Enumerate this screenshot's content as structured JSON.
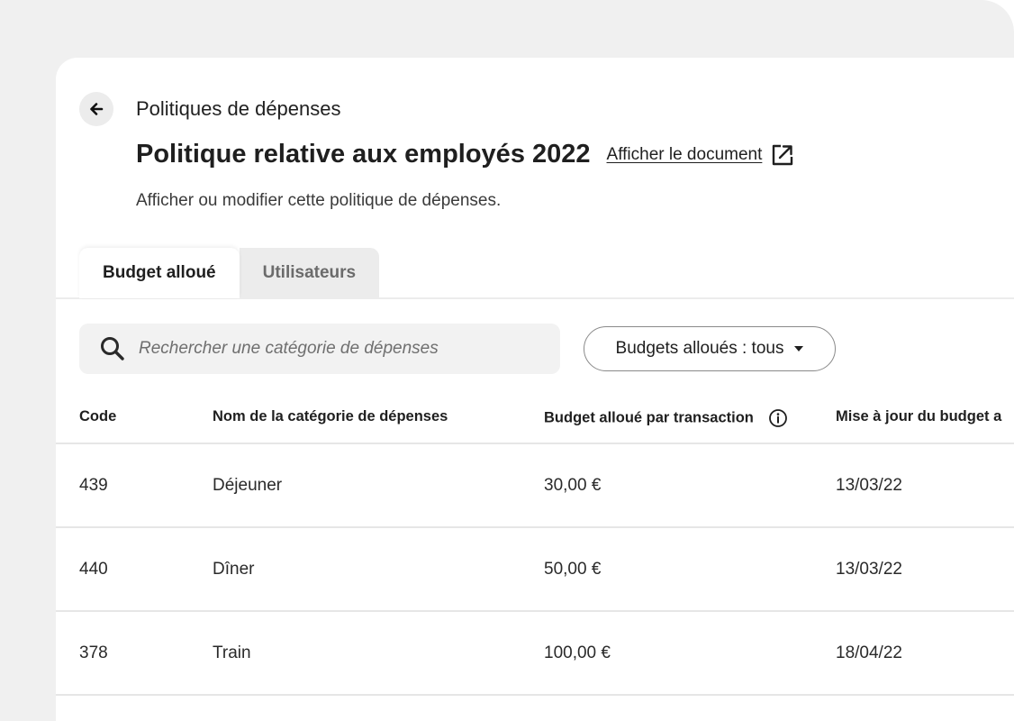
{
  "header": {
    "breadcrumb": "Politiques de dépenses",
    "title": "Politique relative aux employés 2022",
    "doc_link": "Afficher le document",
    "subtitle": "Afficher ou modifier cette politique de dépenses."
  },
  "tabs": [
    {
      "label": "Budget alloué",
      "active": true
    },
    {
      "label": "Utilisateurs",
      "active": false
    }
  ],
  "search": {
    "placeholder": "Rechercher une catégorie de dépenses"
  },
  "filter": {
    "label": "Budgets alloués : tous"
  },
  "table": {
    "headers": {
      "code": "Code",
      "name": "Nom de la catégorie de dépenses",
      "budget": "Budget alloué par transaction",
      "update": "Mise à jour du budget a"
    },
    "rows": [
      {
        "code": "439",
        "name": "Déjeuner",
        "budget": "30,00 €",
        "update": "13/03/22"
      },
      {
        "code": "440",
        "name": "Dîner",
        "budget": "50,00 €",
        "update": "13/03/22"
      },
      {
        "code": "378",
        "name": "Train",
        "budget": "100,00 €",
        "update": "18/04/22"
      }
    ]
  },
  "icons": {
    "back": "arrow-left-icon",
    "external": "external-link-icon",
    "search": "search-icon",
    "info": "info-icon",
    "caret": "caret-down-icon"
  }
}
